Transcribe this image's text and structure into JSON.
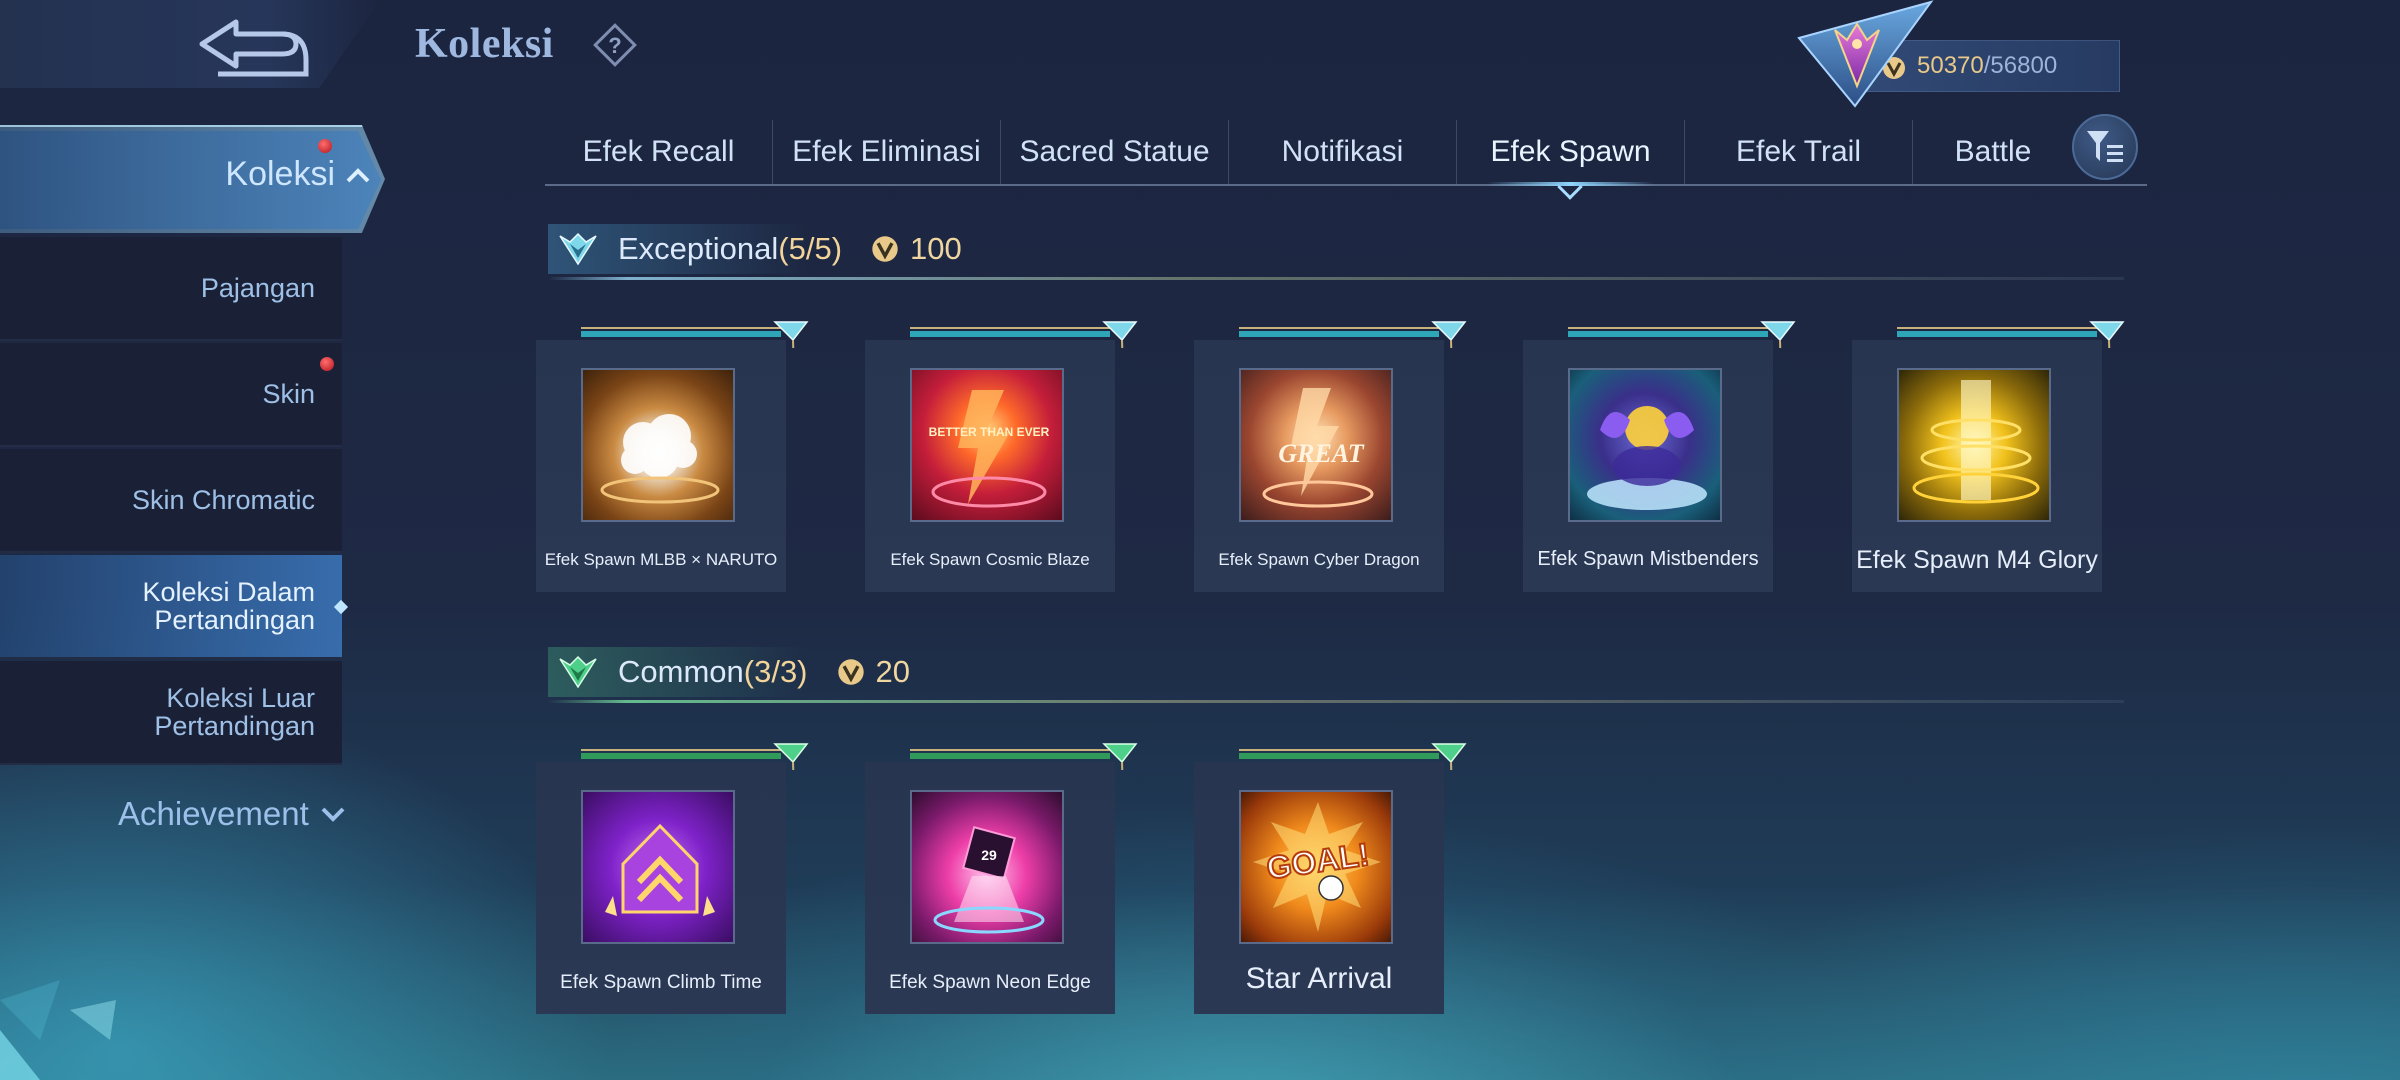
{
  "header": {
    "title": "Koleksi",
    "help": "?",
    "currency_value": "50370",
    "currency_sep": "/",
    "currency_max": "56800"
  },
  "sidebar": {
    "main_label": "Koleksi",
    "items": [
      {
        "label": "Pajangan"
      },
      {
        "label": "Skin"
      },
      {
        "label": "Skin Chromatic"
      },
      {
        "label": "Koleksi Dalam Pertandingan"
      },
      {
        "label": "Koleksi Luar Pertandingan"
      }
    ],
    "achievement": "Achievement"
  },
  "tabs": [
    {
      "label": "Efek Recall"
    },
    {
      "label": "Efek Eliminasi"
    },
    {
      "label": "Sacred Statue"
    },
    {
      "label": "Notifikasi"
    },
    {
      "label": "Efek Spawn"
    },
    {
      "label": "Efek Trail"
    },
    {
      "label": "Battle"
    }
  ],
  "active_tab": "Efek Spawn",
  "sections": [
    {
      "label": "Exceptional",
      "count": "(5/5)",
      "cost": "100",
      "items": [
        {
          "name": "Efek Spawn MLBB × NARUTO"
        },
        {
          "name": "Efek Spawn Cosmic Blaze"
        },
        {
          "name": "Efek Spawn Cyber Dragon"
        },
        {
          "name": "Efek Spawn Mistbenders"
        },
        {
          "name": "Efek Spawn M4 Glory"
        }
      ]
    },
    {
      "label": "Common",
      "count": "(3/3)",
      "cost": "20",
      "items": [
        {
          "name": "Efek Spawn Climb Time"
        },
        {
          "name": "Efek Spawn Neon Edge"
        },
        {
          "name": "Star Arrival"
        }
      ]
    }
  ],
  "thumb_text": {
    "cosmic": "BETTER THAN EVER",
    "cyber": "GREAT",
    "neon": "29",
    "goal": "GOAL!"
  },
  "colors": {
    "accent_gold": "#e8c98a",
    "active_tab": "#8fd6ff",
    "badge_red": "#d41f2c"
  }
}
